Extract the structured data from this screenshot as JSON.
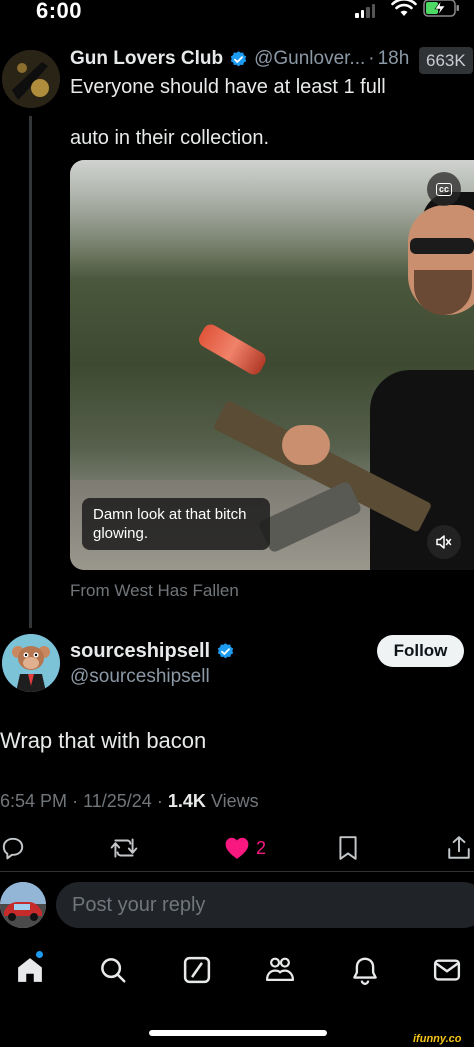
{
  "status_bar": {
    "time": "6:00"
  },
  "quoted_tweet": {
    "author_name": "Gun Lovers Club",
    "handle": "@Gunlover...",
    "separator": "·",
    "age": "18h",
    "views_badge": "663K",
    "text_line1": "Everyone should have at least 1 full",
    "text_line2": "auto in their collection.",
    "video": {
      "cc_label": "cc",
      "caption": "Damn look at that bitch glowing."
    },
    "video_source": "From West Has Fallen"
  },
  "main_tweet": {
    "author_name": "sourceshipsell",
    "handle": "@sourceshipsell",
    "follow_label": "Follow",
    "text": "Wrap that with bacon",
    "time": "6:54 PM",
    "date": "11/25/24",
    "separator": "·",
    "views_count": "1.4K",
    "views_label": "Views",
    "actions": {
      "reply_icon": "reply-icon",
      "retweet_icon": "retweet-icon",
      "like_icon": "heart-filled-icon",
      "like_count": "2",
      "bookmark_icon": "bookmark-icon",
      "share_icon": "share-icon"
    }
  },
  "reply_box": {
    "placeholder": "Post your reply"
  },
  "tab_bar": {
    "items": [
      "home-icon",
      "search-icon",
      "grok-icon",
      "communities-icon",
      "notifications-icon",
      "messages-icon"
    ]
  },
  "watermark": "ifunny.co",
  "colors": {
    "background": "#000000",
    "primary_text": "#e7e9ea",
    "secondary_text": "#71767b",
    "verified_blue": "#1d9bf0",
    "like_pink": "#f91880"
  }
}
